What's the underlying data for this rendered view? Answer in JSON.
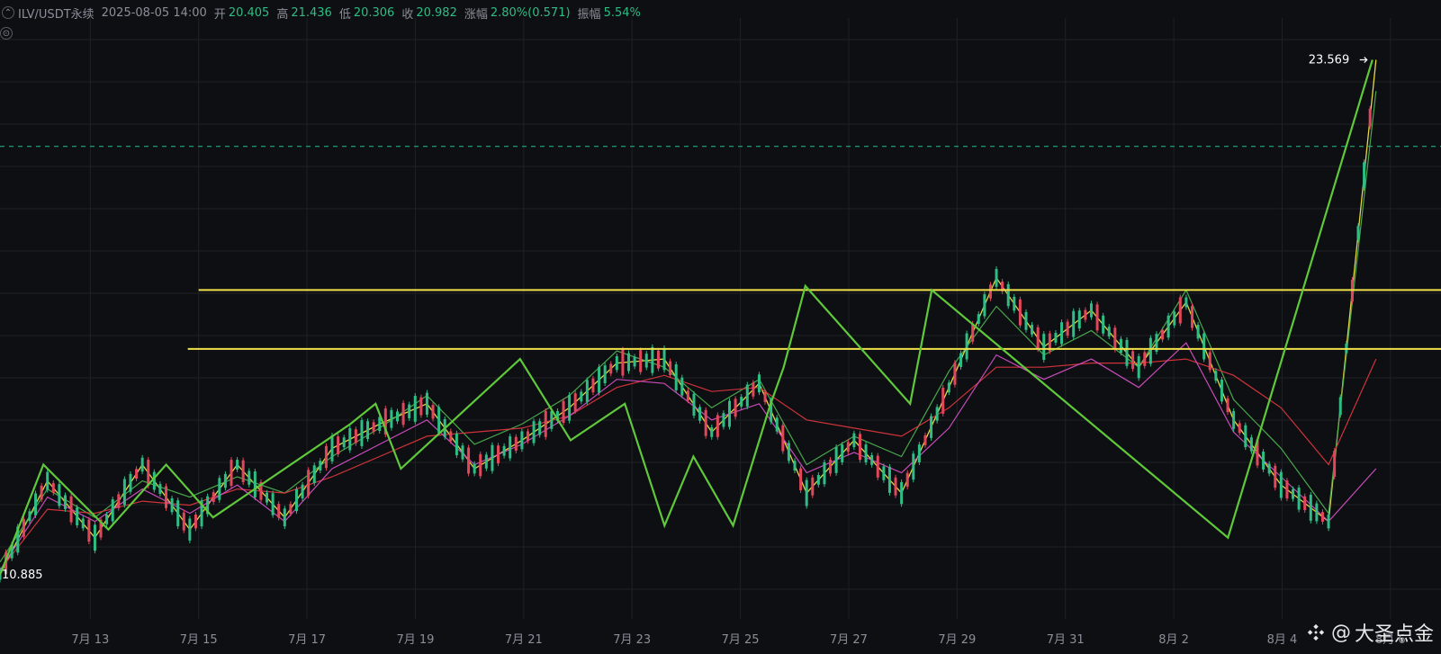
{
  "header": {
    "symbol": "ILV/USDT永续",
    "datetime": "2025-08-05 14:00",
    "open_label": "开",
    "open_value": "20.405",
    "high_label": "高",
    "high_value": "21.436",
    "low_label": "低",
    "low_value": "20.306",
    "close_label": "收",
    "close_value": "20.982",
    "change_label": "涨幅",
    "change_value": "2.80%(0.571)",
    "amplitude_label": "振幅",
    "amplitude_value": "5.54%"
  },
  "colors": {
    "background": "#0e0f12",
    "grid": "#1e2127",
    "green_text": "#2ebd85",
    "yellow_line": "#f0e14a",
    "zigzag": "#5fc93b",
    "ma_red": "#d9363e",
    "ma_magenta": "#d24fc4",
    "candle_up": "#2ebd85",
    "candle_down": "#e0475b",
    "dashed_price": "#2ebd85"
  },
  "watermark": {
    "at": "@",
    "text": "大圣点金"
  },
  "chart_data": {
    "type": "line",
    "series": [
      {
        "values": [
          10.885,
          13.2,
          11.8,
          13.6,
          12.0,
          13.6,
          12.3,
          14.0,
          14.6,
          15.1,
          13.5,
          14.2,
          15.0,
          16.1,
          16.2,
          14.4,
          15.6,
          12.9,
          14.2,
          12.9,
          15.5,
          18.2,
          16.5,
          17.4,
          16.0,
          17.6,
          14.7,
          13.1,
          12.2,
          23.569
        ]
      },
      {
        "values": [
          11.2,
          13.0,
          12.3,
          13.2,
          12.8,
          13.3,
          12.9,
          13.8,
          14.5,
          15.3,
          14.1,
          14.6,
          15.3,
          16.4,
          16.0,
          15.0,
          15.7,
          13.6,
          14.3,
          13.8,
          15.9,
          17.5,
          16.3,
          16.9,
          16.0,
          17.9,
          15.2,
          14.0,
          12.4,
          22.8
        ]
      },
      {
        "values": [
          11.0,
          12.5,
          12.4,
          12.7,
          12.6,
          13.0,
          12.9,
          13.3,
          13.8,
          14.3,
          14.4,
          14.5,
          14.8,
          15.5,
          15.8,
          15.4,
          15.5,
          14.7,
          14.5,
          14.3,
          15.0,
          16.0,
          16.0,
          16.1,
          16.1,
          16.2,
          15.8,
          15.0,
          13.6,
          16.2
        ]
      },
      {
        "values": [
          11.0,
          12.8,
          12.2,
          13.0,
          12.4,
          13.1,
          12.2,
          13.5,
          14.1,
          14.7,
          13.6,
          14.1,
          14.8,
          15.7,
          15.6,
          14.7,
          15.1,
          13.4,
          13.9,
          13.4,
          14.5,
          16.3,
          15.7,
          16.2,
          15.5,
          16.6,
          14.4,
          13.3,
          12.2,
          13.5
        ]
      }
    ],
    "candles_note": "",
    "zigzag_points": [
      [
        0.0,
        10.885
      ],
      [
        1.2,
        13.6
      ],
      [
        3.0,
        12.0
      ],
      [
        4.6,
        13.6
      ],
      [
        5.9,
        12.3
      ],
      [
        9.7,
        14.6
      ],
      [
        10.4,
        15.1
      ],
      [
        11.1,
        13.5
      ],
      [
        14.4,
        16.2
      ],
      [
        15.8,
        14.2
      ],
      [
        17.3,
        15.1
      ],
      [
        18.4,
        12.1
      ],
      [
        19.2,
        13.8
      ],
      [
        20.3,
        12.1
      ],
      [
        21.3,
        15.0
      ],
      [
        21.7,
        16.0
      ],
      [
        22.3,
        18.0
      ],
      [
        25.2,
        15.1
      ],
      [
        25.8,
        17.9
      ],
      [
        34.0,
        11.8
      ],
      [
        38.0,
        23.569
      ]
    ],
    "horizontal_lines": [
      {
        "y": 17.9,
        "x_start": 5.5
      },
      {
        "y": 16.45,
        "x_start": 5.2
      }
    ],
    "dashed_price_line": 21.436,
    "price_labels": [
      {
        "text": "23.569",
        "x": 37.8,
        "y": 23.569
      },
      {
        "text": "10.885",
        "x": 0.0,
        "y": 10.885
      }
    ],
    "x_ticks": [
      "7月 13",
      "7月 15",
      "7月 17",
      "7月 19",
      "7月 21",
      "7月 23",
      "7月 25",
      "7月 27",
      "7月 29",
      "7月 31",
      "8月 2",
      "8月 4",
      "8月 6"
    ],
    "x_tick_positions": [
      2.5,
      5.5,
      8.5,
      11.5,
      14.5,
      17.5,
      20.5,
      23.5,
      26.5,
      29.5,
      32.5,
      35.5,
      38.5
    ],
    "xlim": [
      0,
      39.9
    ],
    "ylim": [
      9.8,
      24.6
    ]
  }
}
